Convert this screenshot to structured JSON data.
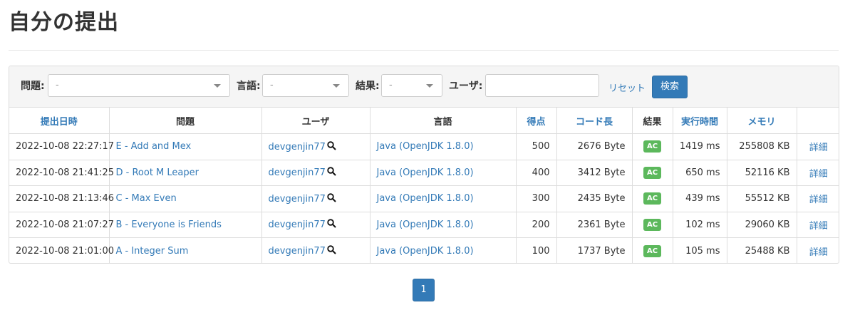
{
  "page_title": "自分の提出",
  "filters": {
    "problem_label": "問題:",
    "problem_value": "-",
    "language_label": "言語:",
    "language_value": "-",
    "result_label": "結果:",
    "result_value": "-",
    "user_label": "ユーザ:",
    "user_value": "",
    "reset_label": "リセット",
    "search_label": "検索"
  },
  "columns": [
    "提出日時",
    "問題",
    "ユーザ",
    "言語",
    "得点",
    "コード長",
    "結果",
    "実行時間",
    "メモリ",
    ""
  ],
  "rows": [
    {
      "date": "2022-10-08 22:27:17",
      "problem": "E - Add and Mex",
      "user": "devgenjin77",
      "lang": "Java (OpenJDK 1.8.0)",
      "score": "500",
      "code": "2676 Byte",
      "result": "AC",
      "time": "1419 ms",
      "memory": "255808 KB",
      "detail": "詳細"
    },
    {
      "date": "2022-10-08 21:41:25",
      "problem": "D - Root M Leaper",
      "user": "devgenjin77",
      "lang": "Java (OpenJDK 1.8.0)",
      "score": "400",
      "code": "3412 Byte",
      "result": "AC",
      "time": "650 ms",
      "memory": "52116 KB",
      "detail": "詳細"
    },
    {
      "date": "2022-10-08 21:13:46",
      "problem": "C - Max Even",
      "user": "devgenjin77",
      "lang": "Java (OpenJDK 1.8.0)",
      "score": "300",
      "code": "2435 Byte",
      "result": "AC",
      "time": "439 ms",
      "memory": "55512 KB",
      "detail": "詳細"
    },
    {
      "date": "2022-10-08 21:07:27",
      "problem": "B - Everyone is Friends",
      "user": "devgenjin77",
      "lang": "Java (OpenJDK 1.8.0)",
      "score": "200",
      "code": "2361 Byte",
      "result": "AC",
      "time": "102 ms",
      "memory": "29060 KB",
      "detail": "詳細"
    },
    {
      "date": "2022-10-08 21:01:00",
      "problem": "A - Integer Sum",
      "user": "devgenjin77",
      "lang": "Java (OpenJDK 1.8.0)",
      "score": "100",
      "code": "1737 Byte",
      "result": "AC",
      "time": "105 ms",
      "memory": "25488 KB",
      "detail": "詳細"
    }
  ],
  "pagination": {
    "current": "1"
  },
  "colors": {
    "link": "#337ab7",
    "ac_badge": "#5cb85c",
    "primary_button": "#337ab7"
  },
  "icons": {
    "user_search": "magnifier-icon",
    "dropdown": "caret-down-icon"
  }
}
